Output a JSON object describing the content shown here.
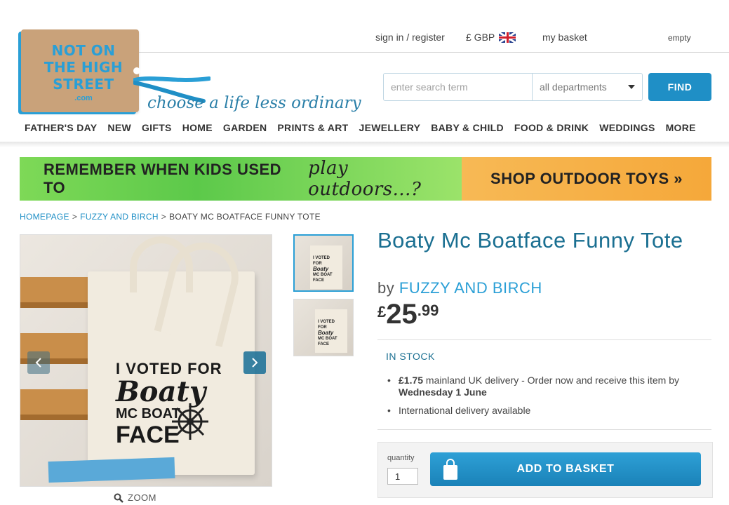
{
  "header": {
    "logo": {
      "line1": "NOT ON",
      "line2": "THE HIGH",
      "line3": "STREET",
      "line4": ".com",
      "tagline": "choose a life less ordinary"
    },
    "sign_in": "sign in / register",
    "currency": "£ GBP",
    "currency_flag_icon": "uk-flag-icon",
    "basket_label": "my basket",
    "basket_status": "empty"
  },
  "search": {
    "placeholder": "enter search term",
    "department": "all departments",
    "button": "FIND"
  },
  "nav": [
    "FATHER'S DAY",
    "NEW",
    "GIFTS",
    "HOME",
    "GARDEN",
    "PRINTS & ART",
    "JEWELLERY",
    "BABY & CHILD",
    "FOOD & DRINK",
    "WEDDINGS",
    "MORE"
  ],
  "banner": {
    "left_text": "REMEMBER WHEN KIDS USED TO",
    "left_script": "play outdoors...?",
    "right_text": "SHOP OUTDOOR TOYS »"
  },
  "breadcrumb": [
    {
      "label": "HOMEPAGE",
      "link": true
    },
    {
      "label": "FUZZY AND BIRCH",
      "link": true
    },
    {
      "label": "BOATY MC BOATFACE FUNNY TOTE",
      "link": false
    }
  ],
  "gallery": {
    "bag_lines": [
      "I VOTED FOR",
      "Boaty",
      "MC BOAT",
      "FACE"
    ],
    "zoom_label": "ZOOM",
    "thumb_lines": [
      "I VOTED FOR",
      "Boaty",
      "MC BOAT",
      "FACE"
    ]
  },
  "product": {
    "title": "Boaty Mc Boatface Funny Tote",
    "by_prefix": "by",
    "seller": "FUZZY AND BIRCH",
    "currency_symbol": "£",
    "price_pounds": "25",
    "price_pence": ".99",
    "stock": "IN STOCK",
    "delivery_price": "£1.75",
    "delivery_text": " mainland UK delivery - Order now and receive this item by ",
    "delivery_date": "Wednesday 1 June",
    "international": "International delivery available"
  },
  "basket": {
    "quantity_label": "quantity",
    "quantity_value": "1",
    "add_button": "ADD TO BASKET"
  },
  "colors": {
    "accent": "#1f8fc6",
    "title": "#1a6f91",
    "banner_green": "#5cc94a",
    "banner_orange": "#f5a83a"
  }
}
